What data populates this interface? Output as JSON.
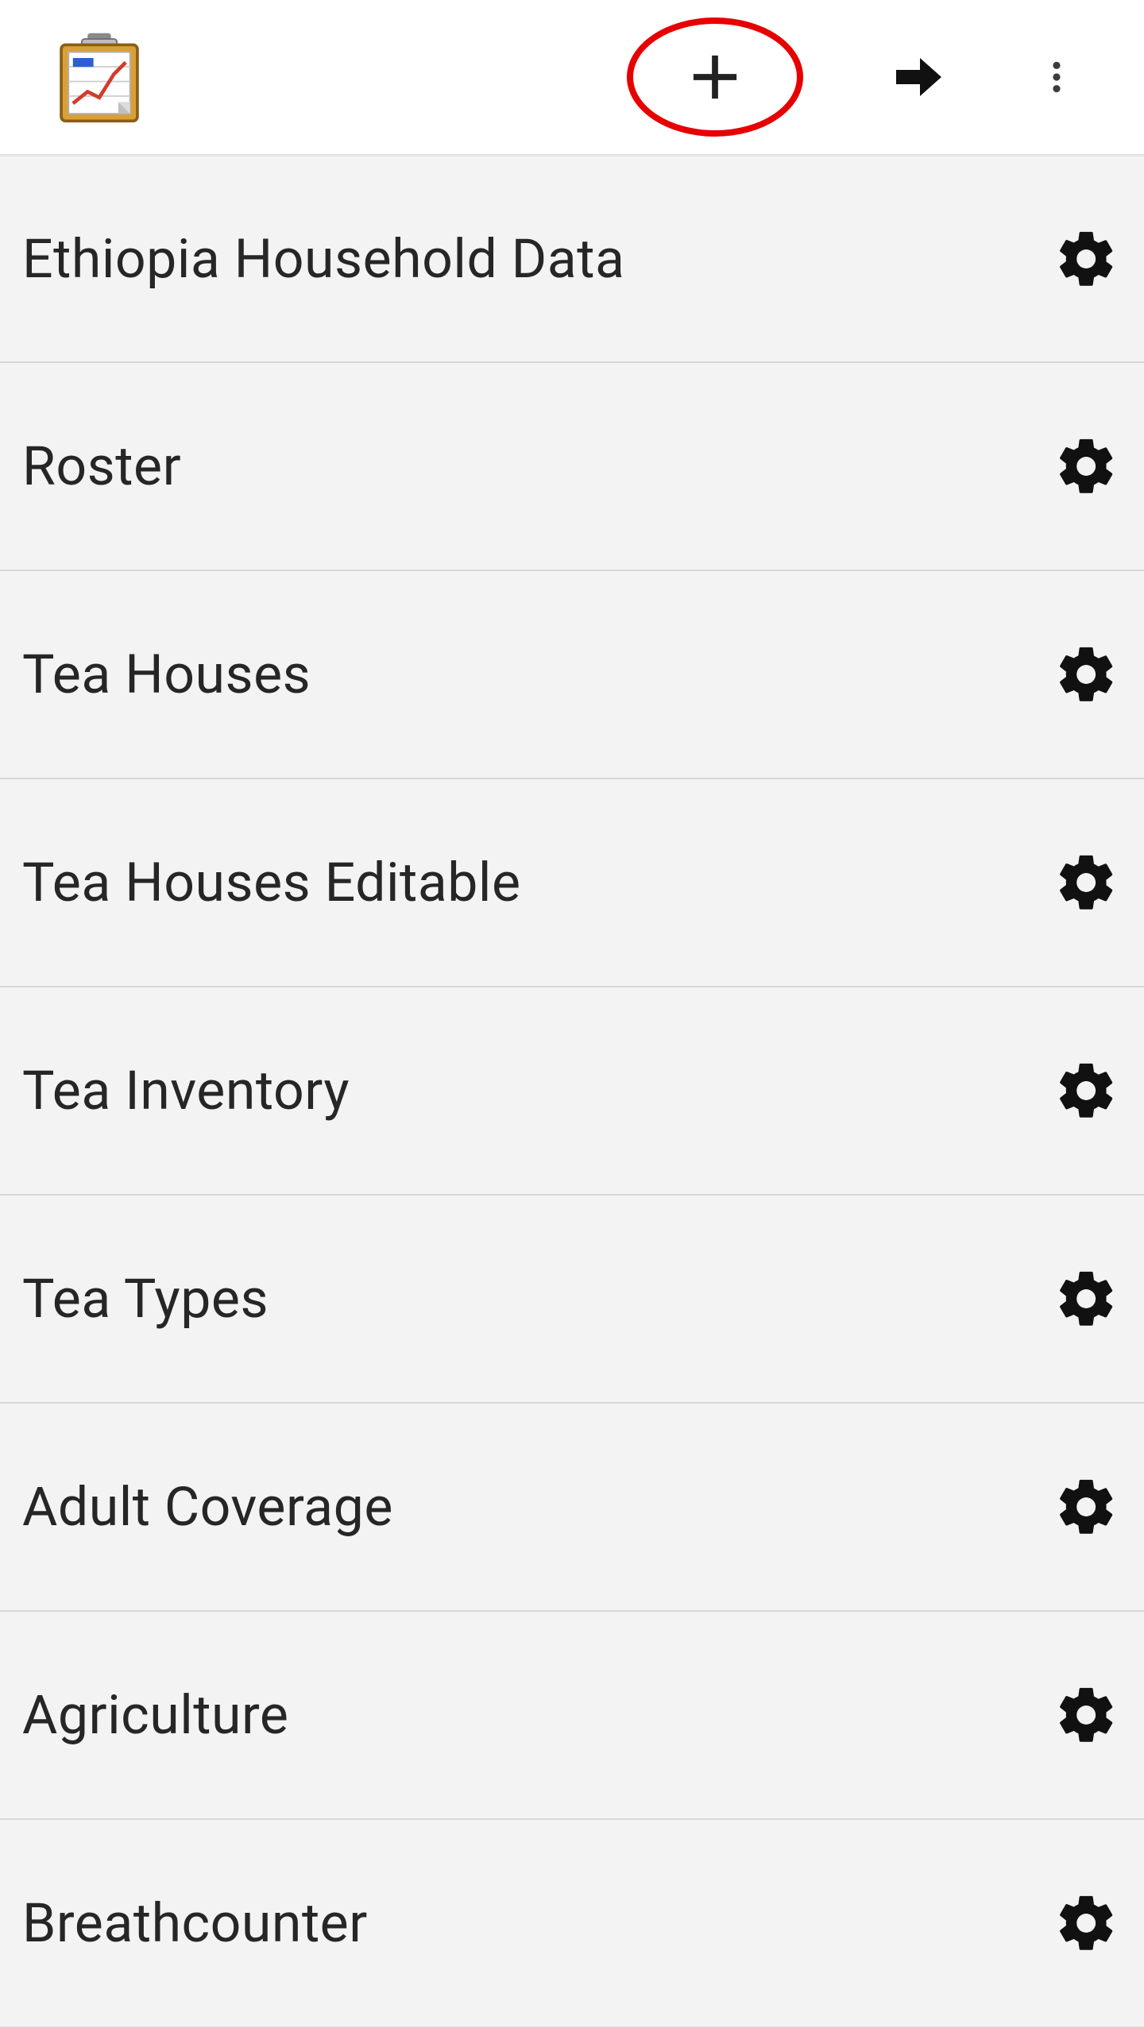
{
  "items": [
    {
      "label": "Ethiopia Household Data"
    },
    {
      "label": "Roster"
    },
    {
      "label": "Tea Houses"
    },
    {
      "label": "Tea Houses Editable"
    },
    {
      "label": "Tea Inventory"
    },
    {
      "label": "Tea Types"
    },
    {
      "label": "Adult Coverage"
    },
    {
      "label": "Agriculture"
    },
    {
      "label": "Breathcounter"
    }
  ]
}
